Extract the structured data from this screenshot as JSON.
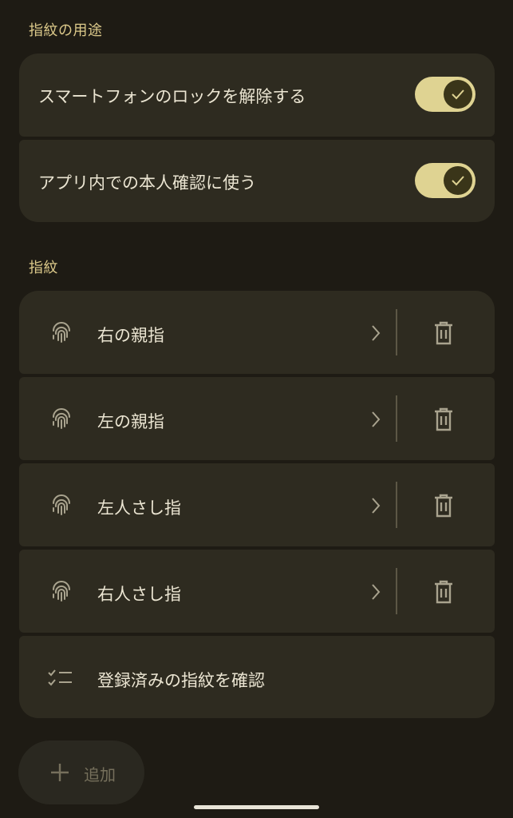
{
  "usage_section": {
    "title": "指紋の用途",
    "items": [
      {
        "label": "スマートフォンのロックを解除する",
        "enabled": true
      },
      {
        "label": "アプリ内での本人確認に使う",
        "enabled": true
      }
    ]
  },
  "fingerprints_section": {
    "title": "指紋",
    "items": [
      {
        "label": "右の親指",
        "icon": "fingerprint-icon"
      },
      {
        "label": "左の親指",
        "icon": "fingerprint-icon"
      },
      {
        "label": "左人さし指",
        "icon": "fingerprint-icon"
      },
      {
        "label": "右人さし指",
        "icon": "fingerprint-icon"
      }
    ],
    "check_label": "登録済みの指紋を確認"
  },
  "fab": {
    "label": "追加",
    "icon": "plus-icon"
  },
  "colors": {
    "background": "#1e1b14",
    "card": "#2e2b20",
    "accent": "#dcc98a",
    "toggle_track": "#dfd392",
    "toggle_knob": "#3a3519"
  }
}
